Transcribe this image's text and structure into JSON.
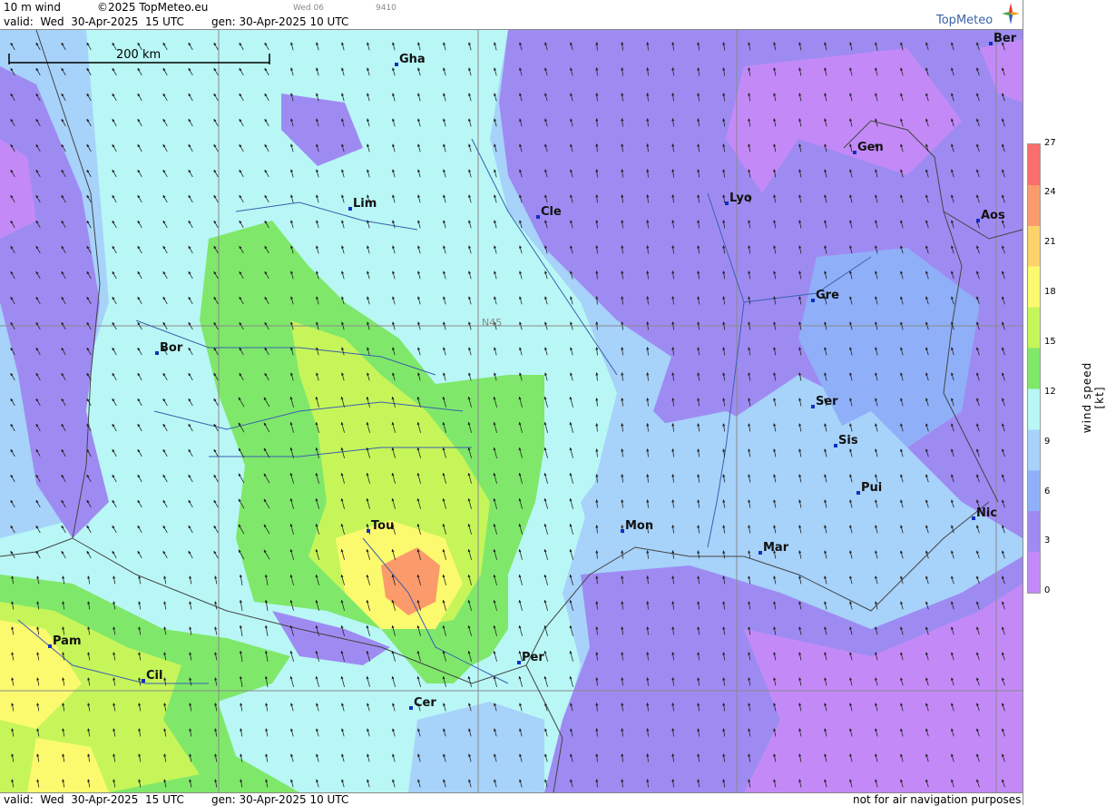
{
  "header": {
    "product": "10 m wind",
    "copyright": "©2025 TopMeteo.eu",
    "valid": "valid:  Wed  30-Apr-2025  15 UTC",
    "gen": "gen: 30-Apr-2025 10 UTC",
    "small_day": "Wed 06",
    "small_code": "9410"
  },
  "logo": {
    "text": "TopMeteo"
  },
  "scale_bar": {
    "label": "200 km"
  },
  "grid_label": "N45",
  "cities": [
    {
      "name": "Gha"
    },
    {
      "name": "Ber"
    },
    {
      "name": "Gen"
    },
    {
      "name": "Lim"
    },
    {
      "name": "Cle"
    },
    {
      "name": "Lyo"
    },
    {
      "name": "Aos"
    },
    {
      "name": "Gre"
    },
    {
      "name": "Bor"
    },
    {
      "name": "Ser"
    },
    {
      "name": "Sis"
    },
    {
      "name": "Pui"
    },
    {
      "name": "Nic"
    },
    {
      "name": "Tou"
    },
    {
      "name": "Mon"
    },
    {
      "name": "Mar"
    },
    {
      "name": "Pam"
    },
    {
      "name": "Cil"
    },
    {
      "name": "Per"
    },
    {
      "name": "Cer"
    }
  ],
  "footer": {
    "valid": "valid:  Wed  30-Apr-2025  15 UTC",
    "gen": "gen: 30-Apr-2025 10 UTC",
    "disclaimer": "not for air navigation purposes"
  },
  "legend": {
    "title": "wind speed [kt]",
    "ticks": [
      "27",
      "24",
      "21",
      "18",
      "15",
      "12",
      "9",
      "6",
      "3",
      "0"
    ],
    "colors": [
      "#fa6e6e",
      "#fb9a6a",
      "#fcd36a",
      "#fbfa6e",
      "#c6f55a",
      "#7fe86a",
      "#b8f7f5",
      "#a7d2fa",
      "#8fb0f8",
      "#9e8bf2",
      "#c38af7"
    ]
  }
}
